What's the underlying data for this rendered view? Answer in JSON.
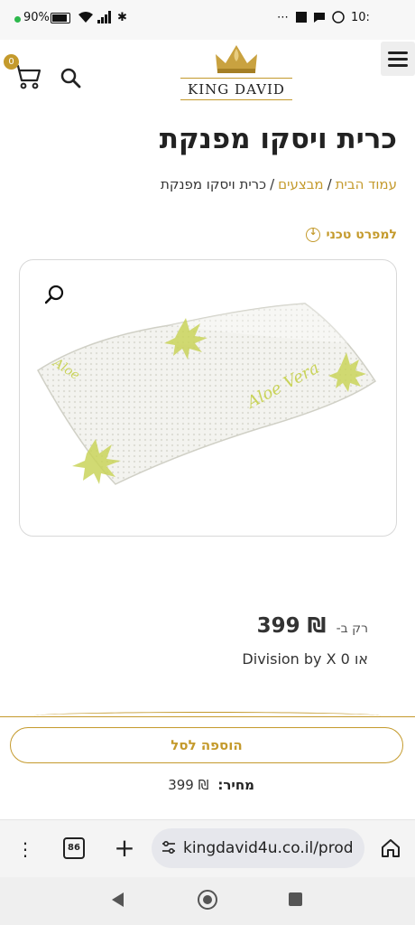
{
  "status_bar": {
    "battery": "90%",
    "time": "10:"
  },
  "header": {
    "cart_count": "0",
    "logo_text": "KING DAVID"
  },
  "product": {
    "title": "כרית ויסקו מפנקת"
  },
  "breadcrumb": {
    "items": [
      "עמוד הבית",
      "מבצעים",
      "כרית ויסקו מפנקת"
    ]
  },
  "spec_link": "למפרט טכני",
  "price": {
    "prefix": "רק ב-",
    "value": "₪ 399",
    "installments": "או 0 Division by X"
  },
  "sticky": {
    "add_to_cart": "הוספה לסל",
    "price_label": "מחיר:",
    "price_value": "₪ 399"
  },
  "browser": {
    "tab_count": "86",
    "url": "kingdavid4u.co.il/prod"
  },
  "colors": {
    "accent": "#c49a2c"
  }
}
